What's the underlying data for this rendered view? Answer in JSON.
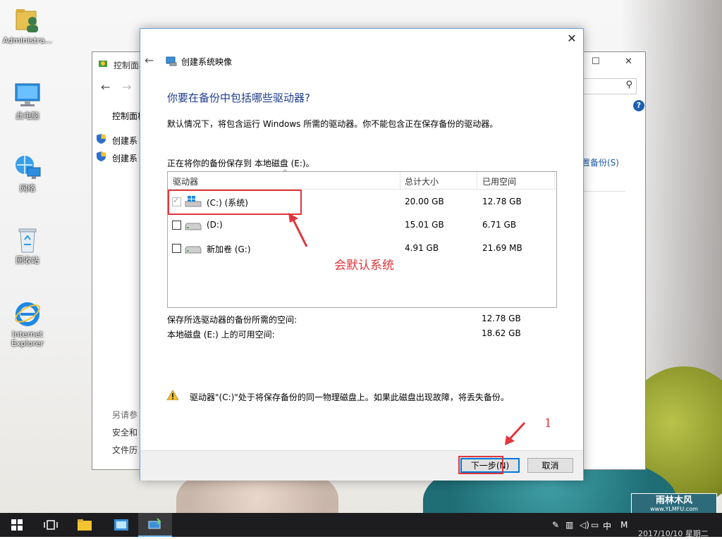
{
  "desktop": {
    "icons": [
      {
        "label": "Administra...",
        "icon": "user-folder-icon"
      },
      {
        "label": "此电脑",
        "icon": "computer-icon"
      },
      {
        "label": "网络",
        "icon": "network-icon"
      },
      {
        "label": "回收站",
        "icon": "recycle-bin-icon"
      },
      {
        "label_line1": "Internet",
        "label_line2": "Explorer",
        "icon": "internet-explorer-icon"
      }
    ]
  },
  "control_panel": {
    "title": "控制面板",
    "breadcrumb": "控制面板",
    "side_links": [
      "创建系",
      "创建系"
    ],
    "right_link": "置备份(S)",
    "see_also": "另请参",
    "bottom_links": [
      "安全和",
      "文件历"
    ],
    "help": "?"
  },
  "dialog": {
    "window_title": "创建系统映像",
    "heading": "你要在备份中包括哪些驱动器?",
    "description": "默认情况下，将包含运行 Windows 所需的驱动器。你不能包含正在保存备份的驱动器。",
    "save_location": "正在将你的备份保存到 本地磁盘 (E:)。",
    "table": {
      "columns": [
        "驱动器",
        "总计大小",
        "已用空间"
      ],
      "rows": [
        {
          "name": "(C:) (系统)",
          "total": "20.00 GB",
          "used": "12.78 GB",
          "checked": true,
          "icon": "windows-drive-icon"
        },
        {
          "name": "(D:)",
          "total": "15.01 GB",
          "used": "6.71 GB",
          "checked": false,
          "icon": "drive-icon"
        },
        {
          "name": "新加卷 (G:)",
          "total": "4.91 GB",
          "used": "21.69 MB",
          "checked": false,
          "icon": "drive-icon"
        }
      ]
    },
    "summary": [
      {
        "label": "保存所选驱动器的备份所需的空间:",
        "value": "12.78 GB"
      },
      {
        "label": "本地磁盘 (E:) 上的可用空间:",
        "value": "18.62 GB"
      }
    ],
    "warning": "驱动器\"(C:)\"处于将保存备份的同一物理磁盘上。如果此磁盘出现故障，将丢失备份。",
    "buttons": {
      "next": "下一步(N)",
      "cancel": "取消"
    }
  },
  "annotations": {
    "default_note": "会默认系统",
    "step": "1"
  },
  "taskbar": {
    "tray_lang": "中",
    "tray_m": "M",
    "clock": "2017/10/10 星期二",
    "watermark_line1": "雨林木风",
    "watermark_line2": "www.YLMFU.com"
  },
  "colors": {
    "accent": "#0078d7",
    "heading": "#1e3c8c",
    "annotation": "#e0353a",
    "taskbar": "#1d1d1f"
  }
}
